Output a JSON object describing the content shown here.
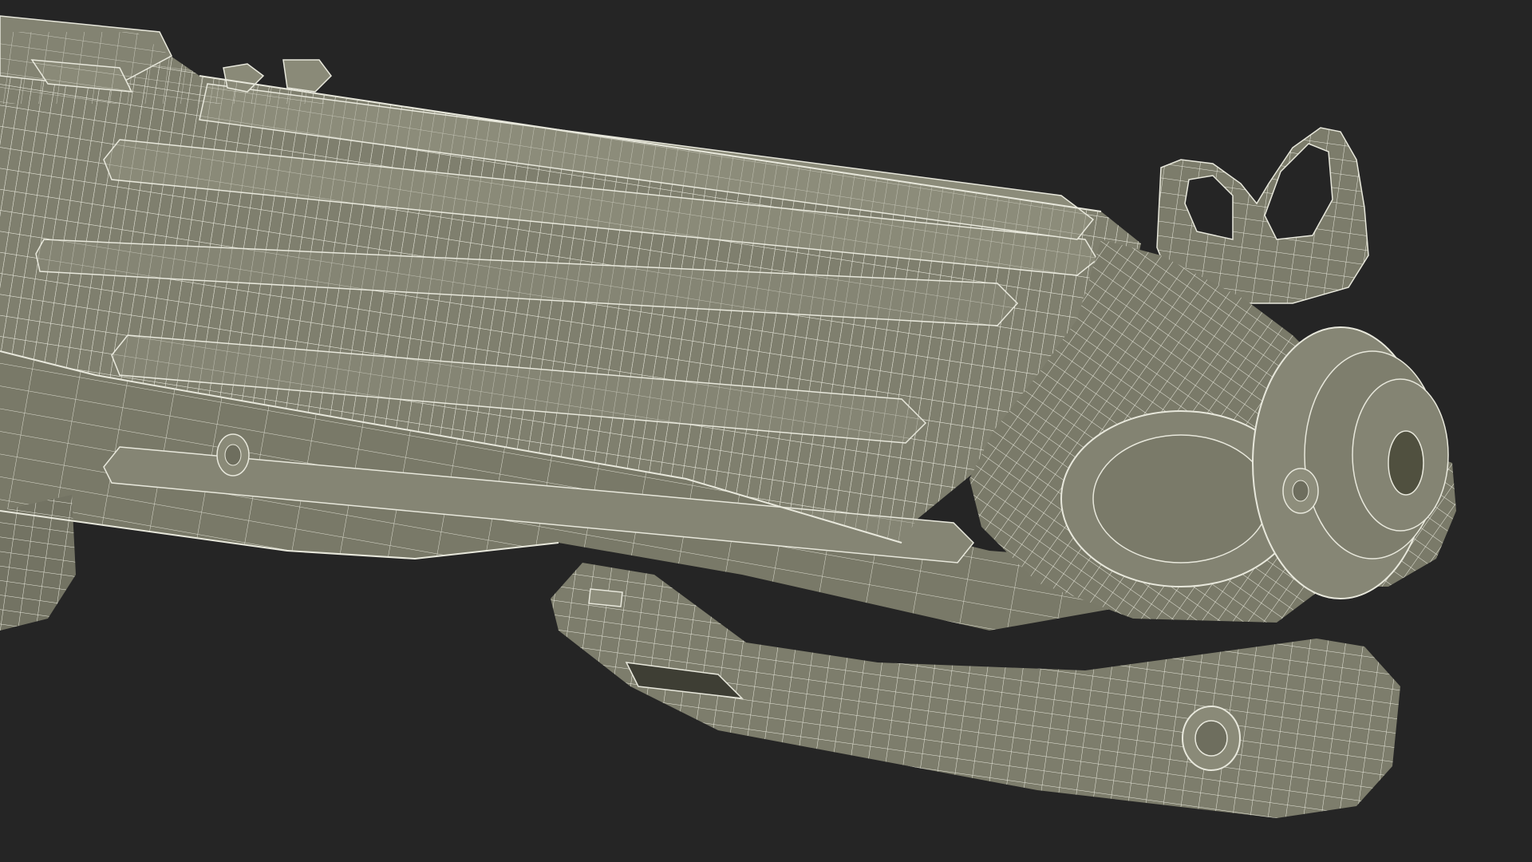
{
  "scene": {
    "background_color": "#252525",
    "surface_color": "#7a7a6a",
    "surface_dark_color": "#5e5e52",
    "surface_light_color": "#8c8c7c",
    "wire_color": "#e8e8dc"
  }
}
